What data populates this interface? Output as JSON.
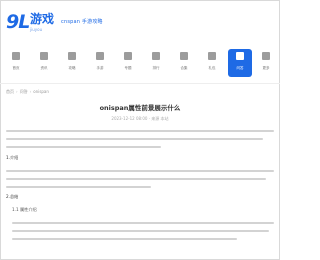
{
  "header": {
    "logo_mark": "9L",
    "logo_name": "游戏",
    "logo_sub": "jiuyou",
    "tag": "cnspan 手游攻略"
  },
  "nav": {
    "items": [
      {
        "label": "首页"
      },
      {
        "label": "资讯"
      },
      {
        "label": "攻略"
      },
      {
        "label": "手游"
      },
      {
        "label": "专题"
      },
      {
        "label": "排行"
      },
      {
        "label": "合集"
      },
      {
        "label": "礼包"
      },
      {
        "label": "问答"
      },
      {
        "label": "更多"
      }
    ],
    "active_index": 8
  },
  "breadcrumb": [
    "首页",
    "问答",
    "onispan"
  ],
  "article": {
    "title": "onispan属性前景展示什么",
    "meta": "2023-12-12 08:00 · 来源 本站",
    "section_label": "1.介绍",
    "section_label_2": "2.总结",
    "sub_item": "1.1  属性介绍"
  },
  "colors": {
    "accent": "#1e6ae5",
    "text": "#333333",
    "muted": "#999999"
  }
}
